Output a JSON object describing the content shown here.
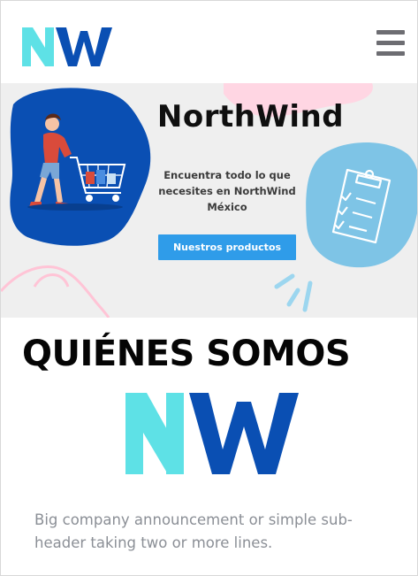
{
  "brand": {
    "logo_text": "NW",
    "colors": {
      "cyan": "#5ee1e6",
      "blue": "#0a4fb3",
      "button": "#2f9ce9"
    }
  },
  "navbar": {
    "menu_icon": "hamburger-menu-icon"
  },
  "hero": {
    "title": "NorthWind",
    "tagline": "Encuentra todo lo que necesites en NorthWind México",
    "button_label": "Nuestros productos",
    "illustrations": [
      "shopping-cart-person-icon",
      "clipboard-checklist-icon"
    ]
  },
  "about": {
    "title": "QUIÉNES SOMOS",
    "subheader": "Big company announcement or simple sub-header taking two or more lines."
  }
}
